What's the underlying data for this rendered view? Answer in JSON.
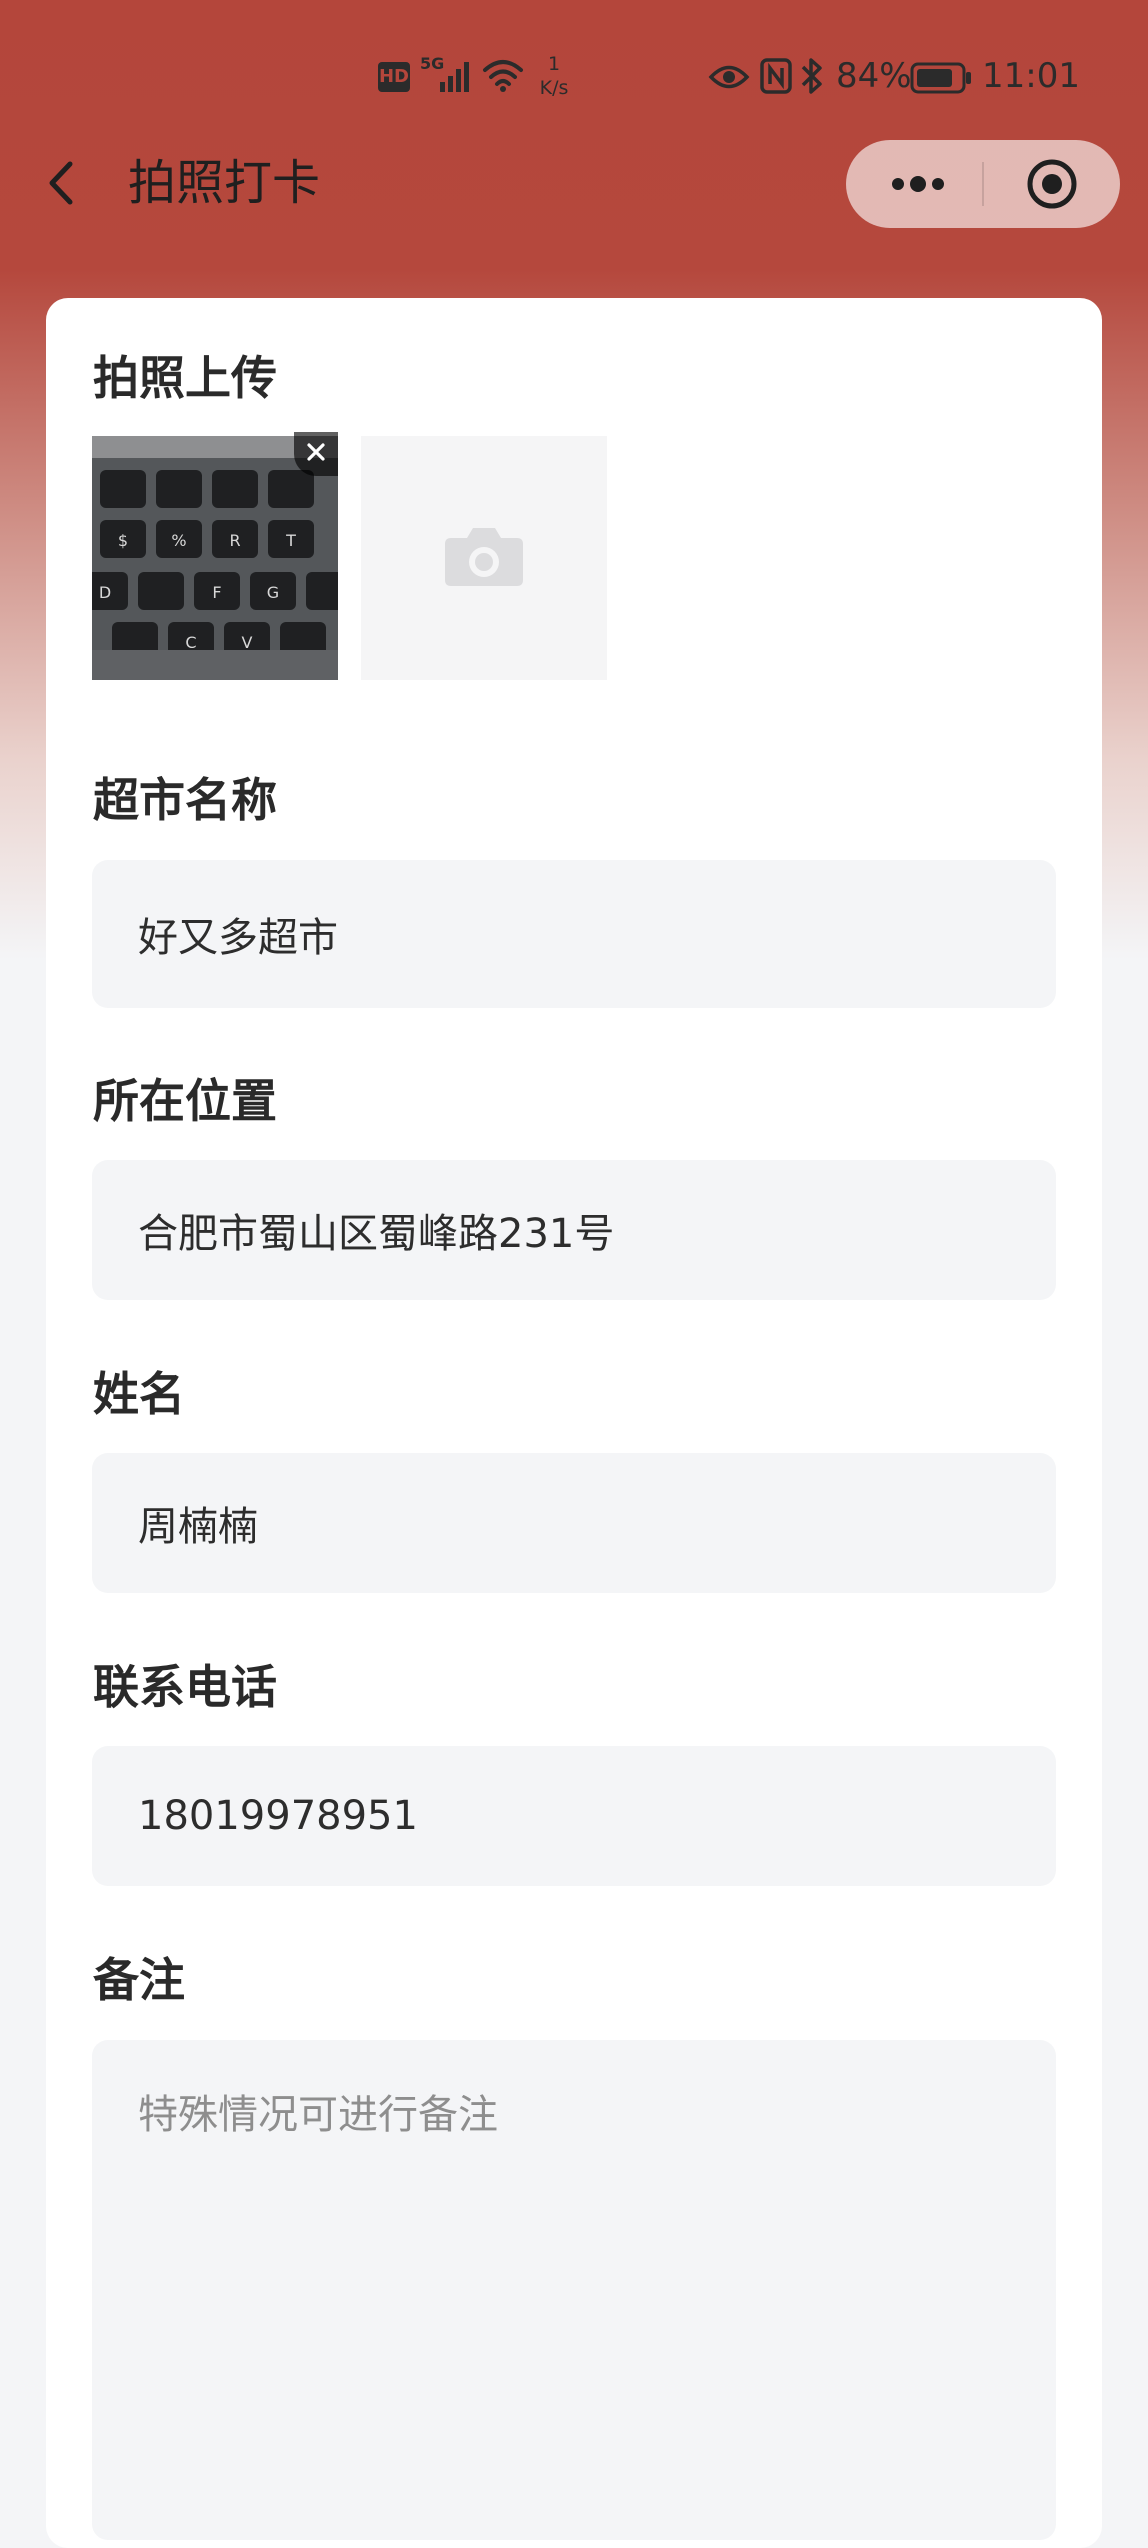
{
  "status_bar": {
    "network_badge": "HD",
    "network_type": "5G",
    "speed_value": "1",
    "speed_unit": "K/s",
    "battery_percent": "84%",
    "battery_level": 0.84,
    "time": "11:01"
  },
  "nav": {
    "title": "拍照打卡",
    "back_icon": "chevron-left-icon",
    "more_icon": "more-dots-icon",
    "close_icon": "target-close-icon"
  },
  "form": {
    "photo_label": "拍照上传",
    "supermarket_label": "超市名称",
    "supermarket_value": "好又多超市",
    "location_label": "所在位置",
    "location_value": "合肥市蜀山区蜀峰路231号",
    "name_label": "姓名",
    "name_value": "周楠楠",
    "phone_label": "联系电话",
    "phone_value": "18019978951",
    "note_label": "备注",
    "note_placeholder": "特殊情况可进行备注",
    "photo_keys": [
      "%",
      "$",
      "R",
      "T",
      "F",
      "G",
      "D",
      "C",
      "V"
    ]
  },
  "colors": {
    "brand_red": "#b4463b",
    "card_bg": "#ffffff",
    "field_bg": "#f4f5f7"
  }
}
